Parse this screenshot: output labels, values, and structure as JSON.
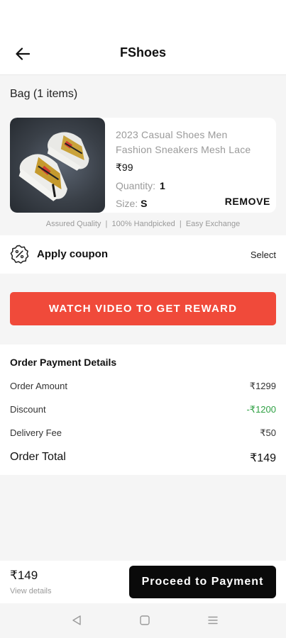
{
  "header": {
    "title": "FShoes"
  },
  "bag": {
    "title": "Bag (1 items)"
  },
  "product": {
    "name": "2023 Casual Shoes Men Fashion Sneakers Mesh Lace",
    "price": "₹99",
    "quantity_label": "Quantity:",
    "quantity_value": "1",
    "size_label": "Size:",
    "size_value": "S",
    "remove_label": "REMOVE"
  },
  "assured_text": "Assured Quality  |  100% Handpicked  |  Easy Exchange",
  "coupon": {
    "label": "Apply coupon",
    "select_label": "Select"
  },
  "reward_button": "WATCH VIDEO TO GET REWARD",
  "payment": {
    "title": "Order Payment Details",
    "rows": [
      {
        "label": "Order Amount",
        "value": "₹1299"
      },
      {
        "label": "Discount",
        "value": "-₹1200"
      },
      {
        "label": "Delivery Fee",
        "value": "₹50"
      }
    ],
    "total_label": "Order Total",
    "total_value": "₹149"
  },
  "footer": {
    "price": "₹149",
    "view_details": "View details",
    "proceed_label": "Proceed to Payment"
  },
  "colors": {
    "accent_red": "#f04a3a",
    "discount_green": "#2ea043",
    "proceed_black": "#0a0a0a"
  },
  "icons": {
    "back": "arrow-left-icon",
    "coupon": "discount-percent-icon",
    "nav_back": "triangle-back-icon",
    "nav_home": "square-home-icon",
    "nav_recent": "menu-lines-icon"
  }
}
